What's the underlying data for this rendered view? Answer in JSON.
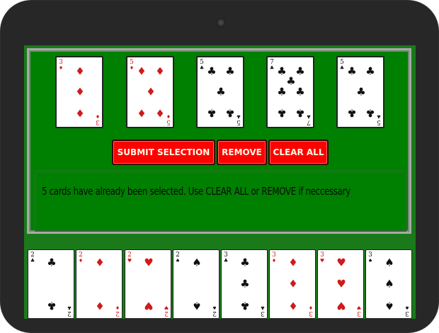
{
  "selected_cards": [
    {
      "rank": "3",
      "suit": "♦",
      "color": "red",
      "pips": [
        [
          33,
          20
        ],
        [
          33,
          49
        ],
        [
          33,
          78
        ]
      ]
    },
    {
      "rank": "5",
      "suit": "♦",
      "color": "red",
      "pips": [
        [
          20,
          20
        ],
        [
          46,
          20
        ],
        [
          33,
          49
        ],
        [
          20,
          78
        ],
        [
          46,
          78
        ]
      ]
    },
    {
      "rank": "5",
      "suit": "♣",
      "color": "black",
      "pips": [
        [
          20,
          20
        ],
        [
          46,
          20
        ],
        [
          33,
          49
        ],
        [
          20,
          78
        ],
        [
          46,
          78
        ]
      ]
    },
    {
      "rank": "7",
      "suit": "♣",
      "color": "black",
      "pips": [
        [
          20,
          20
        ],
        [
          46,
          20
        ],
        [
          33,
          34
        ],
        [
          20,
          49
        ],
        [
          46,
          49
        ],
        [
          20,
          78
        ],
        [
          46,
          78
        ]
      ]
    },
    {
      "rank": "5",
      "suit": "♣",
      "color": "black",
      "pips": [
        [
          20,
          20
        ],
        [
          46,
          20
        ],
        [
          33,
          49
        ],
        [
          20,
          78
        ],
        [
          46,
          78
        ]
      ]
    }
  ],
  "buttons": {
    "submit": "SUBMIT SELECTION",
    "remove": "REMOVE",
    "clear": "CLEAR ALL"
  },
  "message": "5 cards have already been selected. Use CLEAR ALL or REMOVE if neccessary",
  "hand_cards": [
    {
      "rank": "2",
      "suit": "♣",
      "color": "black"
    },
    {
      "rank": "2",
      "suit": "♦",
      "color": "red"
    },
    {
      "rank": "2",
      "suit": "♥",
      "color": "red"
    },
    {
      "rank": "2",
      "suit": "♠",
      "color": "black"
    },
    {
      "rank": "3",
      "suit": "♣",
      "color": "black"
    },
    {
      "rank": "3",
      "suit": "♦",
      "color": "red"
    },
    {
      "rank": "3",
      "suit": "♥",
      "color": "red"
    },
    {
      "rank": "3",
      "suit": "♠",
      "color": "black"
    }
  ],
  "colors": {
    "felt": "#008000",
    "button": "#ff0000",
    "card_red": "#d11a1a",
    "card_black": "#111111"
  }
}
